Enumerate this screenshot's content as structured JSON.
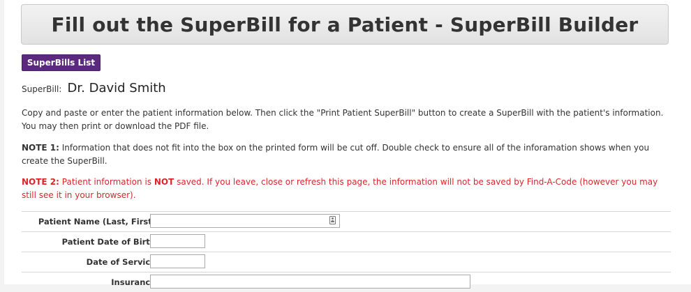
{
  "header": {
    "title": "Fill out the SuperBill for a Patient - SuperBill Builder"
  },
  "toolbar": {
    "superbills_list_label": "SuperBills List"
  },
  "superbill": {
    "label": "SuperBill:",
    "value": "Dr. David Smith"
  },
  "instructions": {
    "text": "Copy and paste or enter the patient information below.  Then click the \"Print Patient SuperBill\" button to create a SuperBill with the patient's information.  You may then print or download the PDF file."
  },
  "note1": {
    "lead": "NOTE 1:",
    "text": " Information that does not fit into the box on the printed form will be cut off.  Double check to ensure all of the inforamation shows when you create the SuperBill."
  },
  "note2": {
    "lead": "NOTE 2:",
    "text_before": " Patient information is ",
    "emphasis": "NOT",
    "text_after": " saved.  If you leave, close or refresh this page, the information will not be saved by Find-A-Code (however you may still see it in your browser)."
  },
  "form": {
    "patient_name": {
      "label": "Patient Name (Last, First)",
      "value": "",
      "icon": "contact-card-icon"
    },
    "patient_dob": {
      "label": "Patient Date of Birth",
      "value": ""
    },
    "date_of_service": {
      "label": "Date of Service",
      "value": ""
    },
    "insurance": {
      "label": "Insurance",
      "value": ""
    }
  },
  "colors": {
    "button_bg": "#5b2a7e",
    "note2_text": "#d9262b",
    "header_bg": "#e8e8e8"
  }
}
